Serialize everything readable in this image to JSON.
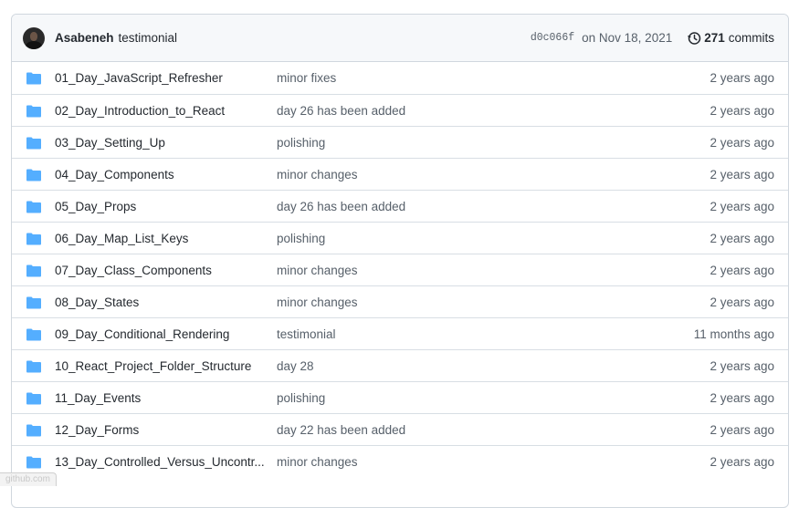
{
  "latest_commit": {
    "author": "Asabeneh",
    "message": "testimonial",
    "sha": "d0c066f",
    "date": "on Nov 18, 2021",
    "commit_count": "271",
    "commits_label": "commits"
  },
  "files": [
    {
      "name": "01_Day_JavaScript_Refresher",
      "message": "minor fixes",
      "age": "2 years ago"
    },
    {
      "name": "02_Day_Introduction_to_React",
      "message": "day 26 has been added",
      "age": "2 years ago"
    },
    {
      "name": "03_Day_Setting_Up",
      "message": "polishing",
      "age": "2 years ago"
    },
    {
      "name": "04_Day_Components",
      "message": "minor changes",
      "age": "2 years ago"
    },
    {
      "name": "05_Day_Props",
      "message": "day 26 has been added",
      "age": "2 years ago"
    },
    {
      "name": "06_Day_Map_List_Keys",
      "message": "polishing",
      "age": "2 years ago"
    },
    {
      "name": "07_Day_Class_Components",
      "message": "minor changes",
      "age": "2 years ago"
    },
    {
      "name": "08_Day_States",
      "message": "minor changes",
      "age": "2 years ago"
    },
    {
      "name": "09_Day_Conditional_Rendering",
      "message": "testimonial",
      "age": "11 months ago"
    },
    {
      "name": "10_React_Project_Folder_Structure",
      "message": "day 28",
      "age": "2 years ago"
    },
    {
      "name": "11_Day_Events",
      "message": "polishing",
      "age": "2 years ago"
    },
    {
      "name": "12_Day_Forms",
      "message": "day 22 has been added",
      "age": "2 years ago"
    },
    {
      "name": "13_Day_Controlled_Versus_Uncontr...",
      "message": "minor changes",
      "age": "2 years ago"
    }
  ],
  "icons": {
    "folder": "folder-icon",
    "history": "history-icon"
  },
  "colors": {
    "folder": "#54aeff",
    "link": "#24292f",
    "muted": "#57606a"
  },
  "status_bar": "github.com"
}
